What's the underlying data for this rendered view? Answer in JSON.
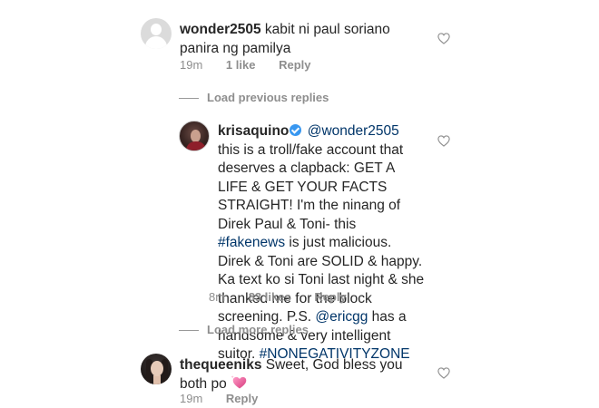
{
  "comments": [
    {
      "username": "wonder2505",
      "text": "kabit ni paul soriano panira ng pamilya",
      "time": "19m",
      "likes": "1 like",
      "reply": "Reply"
    }
  ],
  "load_previous": "Load previous replies",
  "reply": {
    "username": "krisaquino",
    "mention": "@wonder2505",
    "text_1": " this is a troll/fake account that deserves a clapback: GET A LIFE & GET YOUR FACTS STRAIGHT! I'm the ninang of Direk Paul & Toni- this ",
    "hashtag_1": "#fakenews",
    "text_2": " is just malicious. Direk & Toni are SOLID & happy. Ka text ko si Toni last night & she thanked me for the block screening. P.S. ",
    "mention_2": "@ericgg",
    "text_3": " has a handsome & very intelligent suitor. ",
    "hashtag_2": "#NONEGATIVITYZONE",
    "time": "8m",
    "likes": "83 likes",
    "reply": "Reply"
  },
  "load_more": "Load more replies",
  "comment_3": {
    "username": "thequeeniks",
    "text": "Sweet, God bless you both po",
    "time": "19m",
    "reply": "Reply"
  },
  "icons": {
    "like": "heart-outline-icon",
    "verified": "verified-badge-icon",
    "emoji": "sparkling-heart-emoji"
  },
  "colors": {
    "link": "#003569",
    "meta": "#8e8e8e",
    "verified": "#3897f0",
    "emoji_heart": "#e84f8a"
  }
}
